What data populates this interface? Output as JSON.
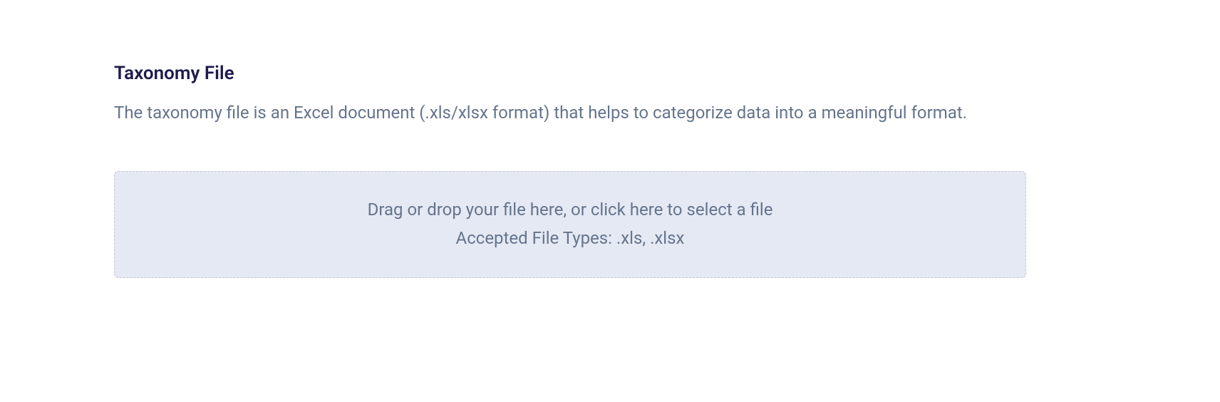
{
  "section": {
    "title": "Taxonomy File",
    "description": "The taxonomy file is an Excel document (.xls/xlsx format) that helps to categorize data into a meaningful format."
  },
  "dropzone": {
    "instruction": "Drag or drop your file here, or click here to select a file",
    "accepted_types": "Accepted File Types: .xls, .xlsx"
  }
}
